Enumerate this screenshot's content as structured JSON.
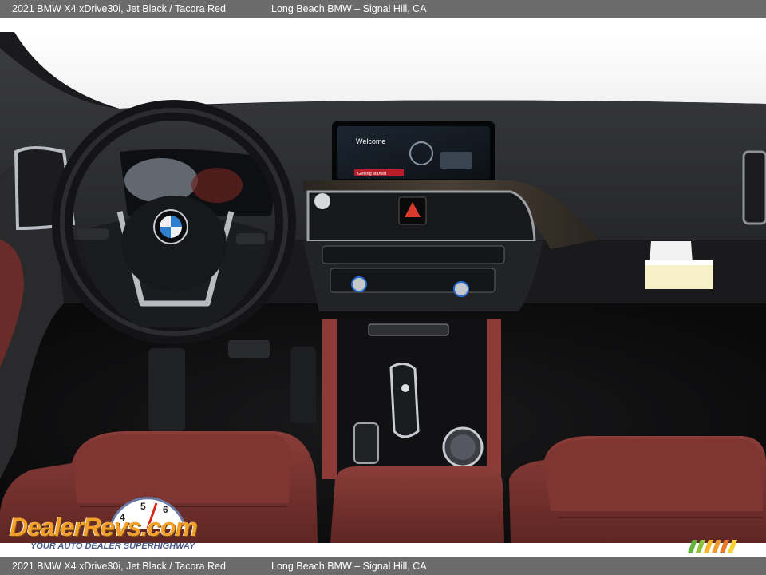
{
  "caption": {
    "vehicle": "2021 BMW X4 xDrive30i,   Jet Black / Tacora Red",
    "dealer": "Long Beach BMW – Signal Hill, CA"
  },
  "screen": {
    "greeting": "Welcome",
    "subtext": "Getting started"
  },
  "watermark": {
    "name": "DealerRevs.com",
    "tagline": "YOUR AUTO DEALER SUPERHIGHWAY",
    "gauge_digits": [
      "4",
      "5",
      "6"
    ]
  },
  "colors": {
    "caption_bar": "#6b6b6b",
    "leather": "#7a3532",
    "dash": "#2c2d30",
    "watermark_orange": "#f2a02a",
    "watermark_blue": "#4a5d8a"
  }
}
